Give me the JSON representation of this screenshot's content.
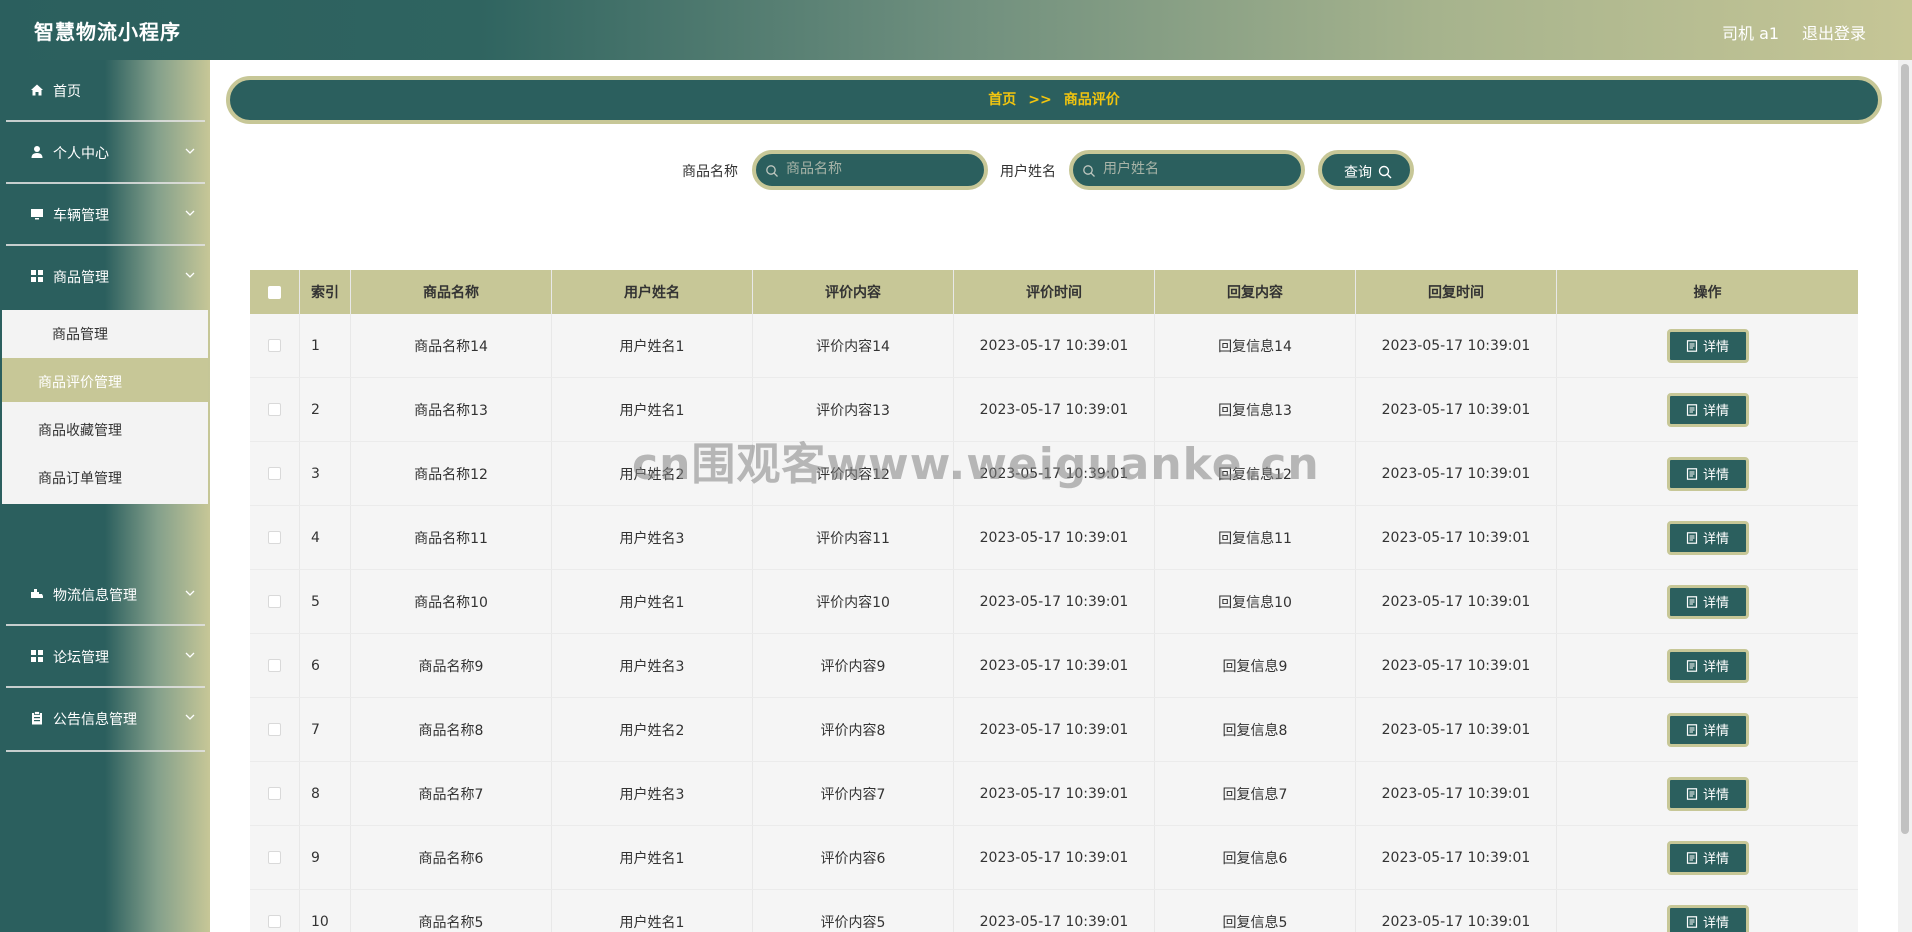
{
  "header": {
    "title": "智慧物流小程序",
    "user": "司机 a1",
    "logout": "退出登录"
  },
  "sidebar": {
    "items": [
      {
        "label": "首页",
        "icon": "home-icon"
      },
      {
        "label": "个人中心",
        "icon": "user-icon"
      },
      {
        "label": "车辆管理",
        "icon": "monitor-icon"
      },
      {
        "label": "商品管理",
        "icon": "grid-icon"
      },
      {
        "label": "物流信息管理",
        "icon": "truck-icon"
      },
      {
        "label": "论坛管理",
        "icon": "grid-icon"
      },
      {
        "label": "公告信息管理",
        "icon": "clipboard-icon"
      }
    ],
    "submenu": [
      "商品管理",
      "商品评价管理",
      "商品收藏管理",
      "商品订单管理"
    ],
    "active_submenu": "商品评价管理"
  },
  "breadcrumb": {
    "home": "首页",
    "sep": ">>",
    "current": "商品评价"
  },
  "search": {
    "product_label": "商品名称",
    "product_placeholder": "商品名称",
    "user_label": "用户姓名",
    "user_placeholder": "用户姓名",
    "query_button": "查询"
  },
  "table": {
    "headers": [
      "索引",
      "商品名称",
      "用户姓名",
      "评价内容",
      "评价时间",
      "回复内容",
      "回复时间",
      "操作"
    ],
    "detail_label": "详情",
    "rows": [
      [
        "1",
        "商品名称14",
        "用户姓名1",
        "评价内容14",
        "2023-05-17 10:39:01",
        "回复信息14",
        "2023-05-17 10:39:01"
      ],
      [
        "2",
        "商品名称13",
        "用户姓名1",
        "评价内容13",
        "2023-05-17 10:39:01",
        "回复信息13",
        "2023-05-17 10:39:01"
      ],
      [
        "3",
        "商品名称12",
        "用户姓名2",
        "评价内容12",
        "2023-05-17 10:39:01",
        "回复信息12",
        "2023-05-17 10:39:01"
      ],
      [
        "4",
        "商品名称11",
        "用户姓名3",
        "评价内容11",
        "2023-05-17 10:39:01",
        "回复信息11",
        "2023-05-17 10:39:01"
      ],
      [
        "5",
        "商品名称10",
        "用户姓名1",
        "评价内容10",
        "2023-05-17 10:39:01",
        "回复信息10",
        "2023-05-17 10:39:01"
      ],
      [
        "6",
        "商品名称9",
        "用户姓名3",
        "评价内容9",
        "2023-05-17 10:39:01",
        "回复信息9",
        "2023-05-17 10:39:01"
      ],
      [
        "7",
        "商品名称8",
        "用户姓名2",
        "评价内容8",
        "2023-05-17 10:39:01",
        "回复信息8",
        "2023-05-17 10:39:01"
      ],
      [
        "8",
        "商品名称7",
        "用户姓名3",
        "评价内容7",
        "2023-05-17 10:39:01",
        "回复信息7",
        "2023-05-17 10:39:01"
      ],
      [
        "9",
        "商品名称6",
        "用户姓名1",
        "评价内容6",
        "2023-05-17 10:39:01",
        "回复信息6",
        "2023-05-17 10:39:01"
      ],
      [
        "10",
        "商品名称5",
        "用户姓名1",
        "评价内容5",
        "2023-05-17 10:39:01",
        "回复信息5",
        "2023-05-17 10:39:01"
      ]
    ]
  },
  "watermark": "cn围观客www.weiguanke.cn",
  "colors": {
    "primary": "#2b5f5e",
    "accent": "#c7c797",
    "breadcrumb_text": "#f1c40f"
  }
}
